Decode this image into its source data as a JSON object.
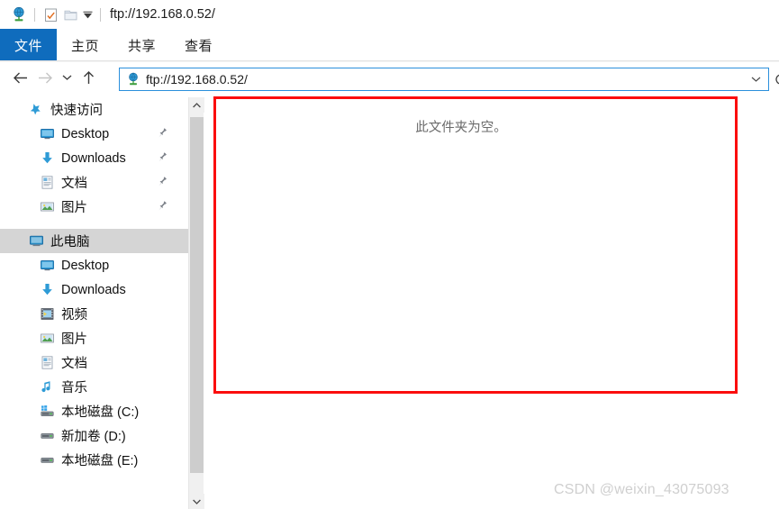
{
  "window": {
    "title": "ftp://192.168.0.52/",
    "quick_access_toolbar": [
      {
        "name": "ftp-site-icon",
        "label": "FTP 站点"
      },
      {
        "name": "properties-icon",
        "label": "属性"
      },
      {
        "name": "new-folder-icon",
        "label": "新建文件夹"
      },
      {
        "name": "customize-qat-caret",
        "label": "▾"
      }
    ]
  },
  "ribbon": {
    "tabs": [
      {
        "label": "文件",
        "active": true,
        "name": "tab-file"
      },
      {
        "label": "主页",
        "active": false,
        "name": "tab-home"
      },
      {
        "label": "共享",
        "active": false,
        "name": "tab-share"
      },
      {
        "label": "查看",
        "active": false,
        "name": "tab-view"
      }
    ]
  },
  "navigation": {
    "back": "←",
    "forward": "→",
    "history_caret": "⌄",
    "up": "↑",
    "refresh": "⟳",
    "address": {
      "value": "ftp://192.168.0.52/",
      "placeholder": "ftp://192.168.0.52/",
      "icon": "ftp-globe-icon",
      "dropdown_caret": "⌄"
    }
  },
  "sidebar": {
    "items": [
      {
        "label": "快速访问",
        "icon": "pin-star-icon",
        "level": 0,
        "selected": false,
        "pinned": false
      },
      {
        "label": "Desktop",
        "icon": "desktop-monitor-icon",
        "level": 1,
        "selected": false,
        "pinned": true
      },
      {
        "label": "Downloads",
        "icon": "downloads-arrow-icon",
        "level": 1,
        "selected": false,
        "pinned": true
      },
      {
        "label": "文档",
        "icon": "documents-icon",
        "level": 1,
        "selected": false,
        "pinned": true
      },
      {
        "label": "图片",
        "icon": "pictures-icon",
        "level": 1,
        "selected": false,
        "pinned": true
      },
      {
        "label": "此电脑",
        "icon": "this-pc-icon",
        "level": 0,
        "selected": true,
        "pinned": false
      },
      {
        "label": "Desktop",
        "icon": "desktop-monitor-icon",
        "level": 1,
        "selected": false,
        "pinned": false
      },
      {
        "label": "Downloads",
        "icon": "downloads-arrow-icon",
        "level": 1,
        "selected": false,
        "pinned": false
      },
      {
        "label": "视频",
        "icon": "videos-icon",
        "level": 1,
        "selected": false,
        "pinned": false
      },
      {
        "label": "图片",
        "icon": "pictures-icon",
        "level": 1,
        "selected": false,
        "pinned": false
      },
      {
        "label": "文档",
        "icon": "documents-icon",
        "level": 1,
        "selected": false,
        "pinned": false
      },
      {
        "label": "音乐",
        "icon": "music-note-icon",
        "level": 1,
        "selected": false,
        "pinned": false
      },
      {
        "label": "本地磁盘 (C:)",
        "icon": "system-drive-icon",
        "level": 1,
        "selected": false,
        "pinned": false
      },
      {
        "label": "新加卷 (D:)",
        "icon": "drive-icon",
        "level": 1,
        "selected": false,
        "pinned": false
      },
      {
        "label": "本地磁盘 (E:)",
        "icon": "drive-icon",
        "level": 1,
        "selected": false,
        "pinned": false
      }
    ],
    "scrollbar": {
      "up_arrow": "⌃",
      "down_arrow": "⌄"
    }
  },
  "content": {
    "empty_message": "此文件夹为空。"
  },
  "annotation": {
    "color": "#fb0d0d"
  },
  "watermark": {
    "text": "CSDN @weixin_43075093"
  }
}
